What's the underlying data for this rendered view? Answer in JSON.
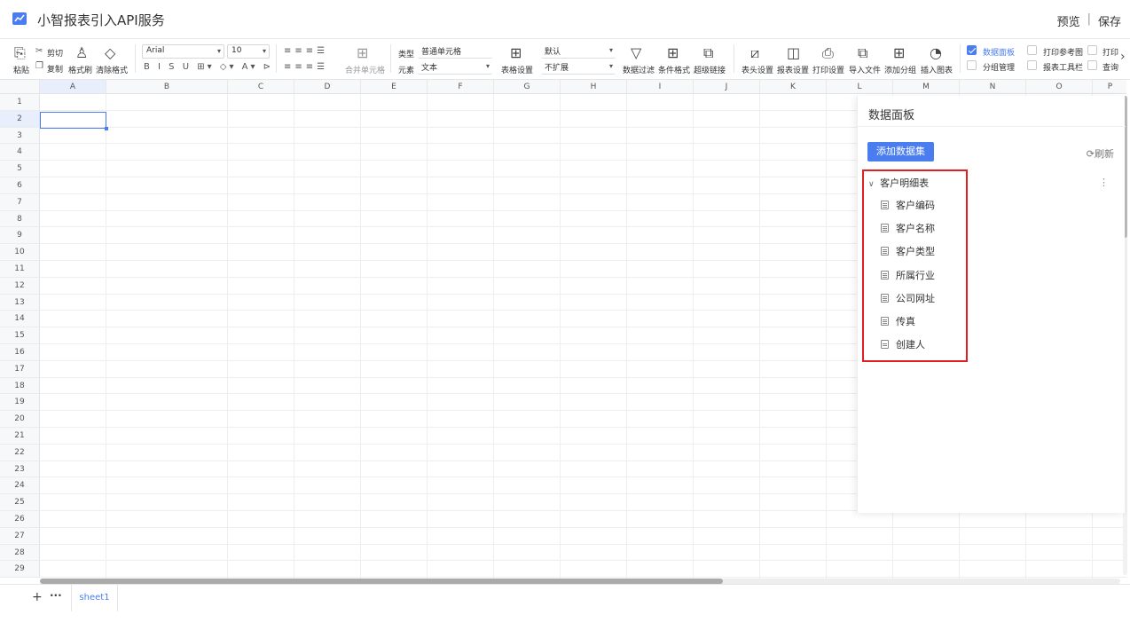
{
  "app": {
    "title": "小智报表引入API服务",
    "preview": "预览",
    "separator": "|",
    "save": "保存"
  },
  "toolbar": {
    "paste": "粘贴",
    "cut": "剪切",
    "copy": "复制",
    "format_painter": "格式刷",
    "clear_format": "清除格式",
    "font_family": "Arial",
    "font_size": "10",
    "merge_cells": "合并单元格",
    "type_label": "类型",
    "type_value": "普通单元格",
    "element_label": "元素",
    "element_value": "文本",
    "table_settings": "表格设置",
    "expand_default": "默认",
    "expand_value": "不扩展",
    "data_filter": "数据过滤",
    "conditional_format": "条件格式",
    "hyperlink": "超级链接",
    "header_settings": "表头设置",
    "report_settings": "报表设置",
    "print_settings": "打印设置",
    "import_file": "导入文件",
    "add_group": "添加分组",
    "insert_chart": "插入图表",
    "data_panel": "数据面板",
    "group_manage": "分组管理",
    "print_ref": "打印参考图",
    "report_toolbar": "报表工具栏",
    "print_short": "打印",
    "query_short": "查询"
  },
  "grid": {
    "columns": [
      "A",
      "B",
      "C",
      "D",
      "E",
      "F",
      "G",
      "H",
      "I",
      "J",
      "K",
      "L",
      "M",
      "N",
      "O",
      "P"
    ],
    "rows": [
      "1",
      "2",
      "3",
      "4",
      "5",
      "6",
      "7",
      "8",
      "9",
      "10",
      "11",
      "12",
      "13",
      "14",
      "15",
      "16",
      "17",
      "18",
      "19",
      "20",
      "21",
      "22",
      "23",
      "24",
      "25",
      "26",
      "27",
      "28",
      "29"
    ],
    "selected_cell": "A2"
  },
  "sheets": {
    "add": "+",
    "more": "···",
    "tabs": [
      "sheet1"
    ]
  },
  "panel": {
    "title": "数据面板",
    "add_dataset": "添加数据集",
    "refresh": "⟳刷新",
    "dataset": {
      "name": "客户明细表",
      "expanded": true,
      "fields": [
        "客户编码",
        "客户名称",
        "客户类型",
        "所属行业",
        "公司网址",
        "传真",
        "创建人"
      ]
    }
  },
  "colors": {
    "accent": "#4a7df0",
    "highlight": "#e02020"
  }
}
